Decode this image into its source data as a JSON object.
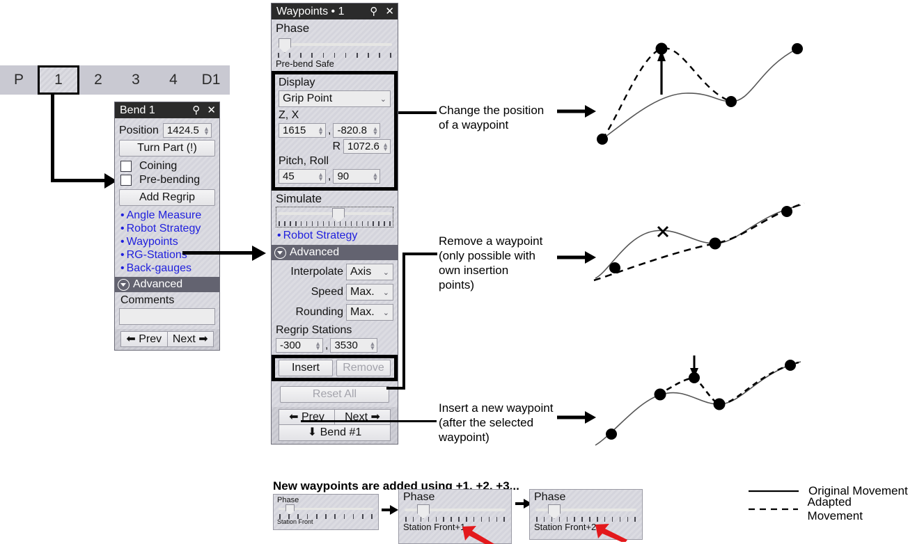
{
  "tabstrip": {
    "name": "bend-sequence-tabs",
    "tabs": [
      "P",
      "1",
      "2",
      "3",
      "4",
      "D1"
    ],
    "selected": "1"
  },
  "bend_panel": {
    "title": "Bend 1",
    "pin_icon": "pin-icon",
    "close_icon": "close-icon",
    "position_label": "Position",
    "position_value": "1424.5",
    "turn_part": "Turn Part (!)",
    "coining": "Coining",
    "prebending": "Pre-bending",
    "add_regrip": "Add Regrip",
    "links": [
      "Angle Measure",
      "Robot Strategy",
      "Waypoints",
      "RG-Stations",
      "Back-gauges"
    ],
    "advanced": "Advanced",
    "comments_label": "Comments",
    "comments_value": "",
    "prev": "Prev",
    "next": "Next"
  },
  "waypoints_panel": {
    "title": "Waypoints • 1",
    "pin_icon": "pin-icon",
    "close_icon": "close-icon",
    "phase_label": "Phase",
    "phase_value": "Pre-bend Safe",
    "display_label": "Display",
    "display_value": "Grip Point",
    "zx_label": "Z, X",
    "z_value": "1615",
    "x_value": "-820.8",
    "r_label": "R",
    "r_value": "1072.6",
    "pitchroll_label": "Pitch, Roll",
    "pitch_value": "45",
    "roll_value": "90",
    "simulate_label": "Simulate",
    "robot_strategy_link": "Robot Strategy",
    "advanced": "Advanced",
    "interpolate_label": "Interpolate",
    "interpolate_value": "Axis",
    "speed_label": "Speed",
    "speed_value": "Max.",
    "rounding_label": "Rounding",
    "rounding_value": "Max.",
    "regrip_label": "Regrip Stations",
    "regrip_a": "-300",
    "regrip_b": "3530",
    "insert": "Insert",
    "remove": "Remove",
    "reset_all": "Reset All",
    "prev": "Prev",
    "next": "Next",
    "bend_nav": "Bend #1"
  },
  "annotations": {
    "change_position": "Change the position\nof a waypoint",
    "remove_waypoint": "Remove a waypoint\n(only possible with\nown insertion\npoints)",
    "insert_waypoint": "Insert a new waypoint\n(after the selected\nwaypoint)",
    "new_waypoints_note": "New waypoints are added using +1, +2, +3..."
  },
  "mini_panels": [
    {
      "phase_label": "Phase",
      "value": "Station Front"
    },
    {
      "phase_label": "Phase",
      "value": "Station Front+1"
    },
    {
      "phase_label": "Phase",
      "value": "Station Front+2"
    }
  ],
  "legend": [
    {
      "style": "solid",
      "label": "Original Movement"
    },
    {
      "style": "dashed",
      "label": "Adapted Movement"
    }
  ],
  "colors": {
    "link": "#2020dd",
    "panel_bg": "#d4d4dc",
    "title_bg": "#2b2b2b",
    "advanced_bg": "#636370",
    "arrow_red": "#e3191c"
  }
}
